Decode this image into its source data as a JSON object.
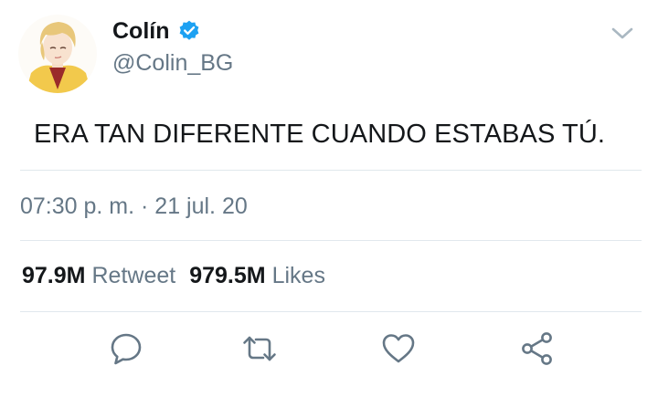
{
  "user": {
    "display_name": "Colín",
    "handle": "@Colin_BG"
  },
  "tweet": {
    "text": "ERA TAN DIFERENTE CUANDO ESTABAS TÚ.",
    "timestamp": "07:30 p. m. · 21 jul. 20"
  },
  "stats": {
    "retweets_count": "97.9M",
    "retweets_label": "Retweet",
    "likes_count": "979.5M",
    "likes_label": "Likes"
  },
  "colors": {
    "verified": "#1da1f2",
    "secondary_text": "#657786",
    "divider": "#e1e8ed",
    "icon": "#657786"
  },
  "icons": [
    "verified-badge-icon",
    "chevron-down-icon",
    "reply-icon",
    "retweet-icon",
    "like-icon",
    "share-icon"
  ]
}
